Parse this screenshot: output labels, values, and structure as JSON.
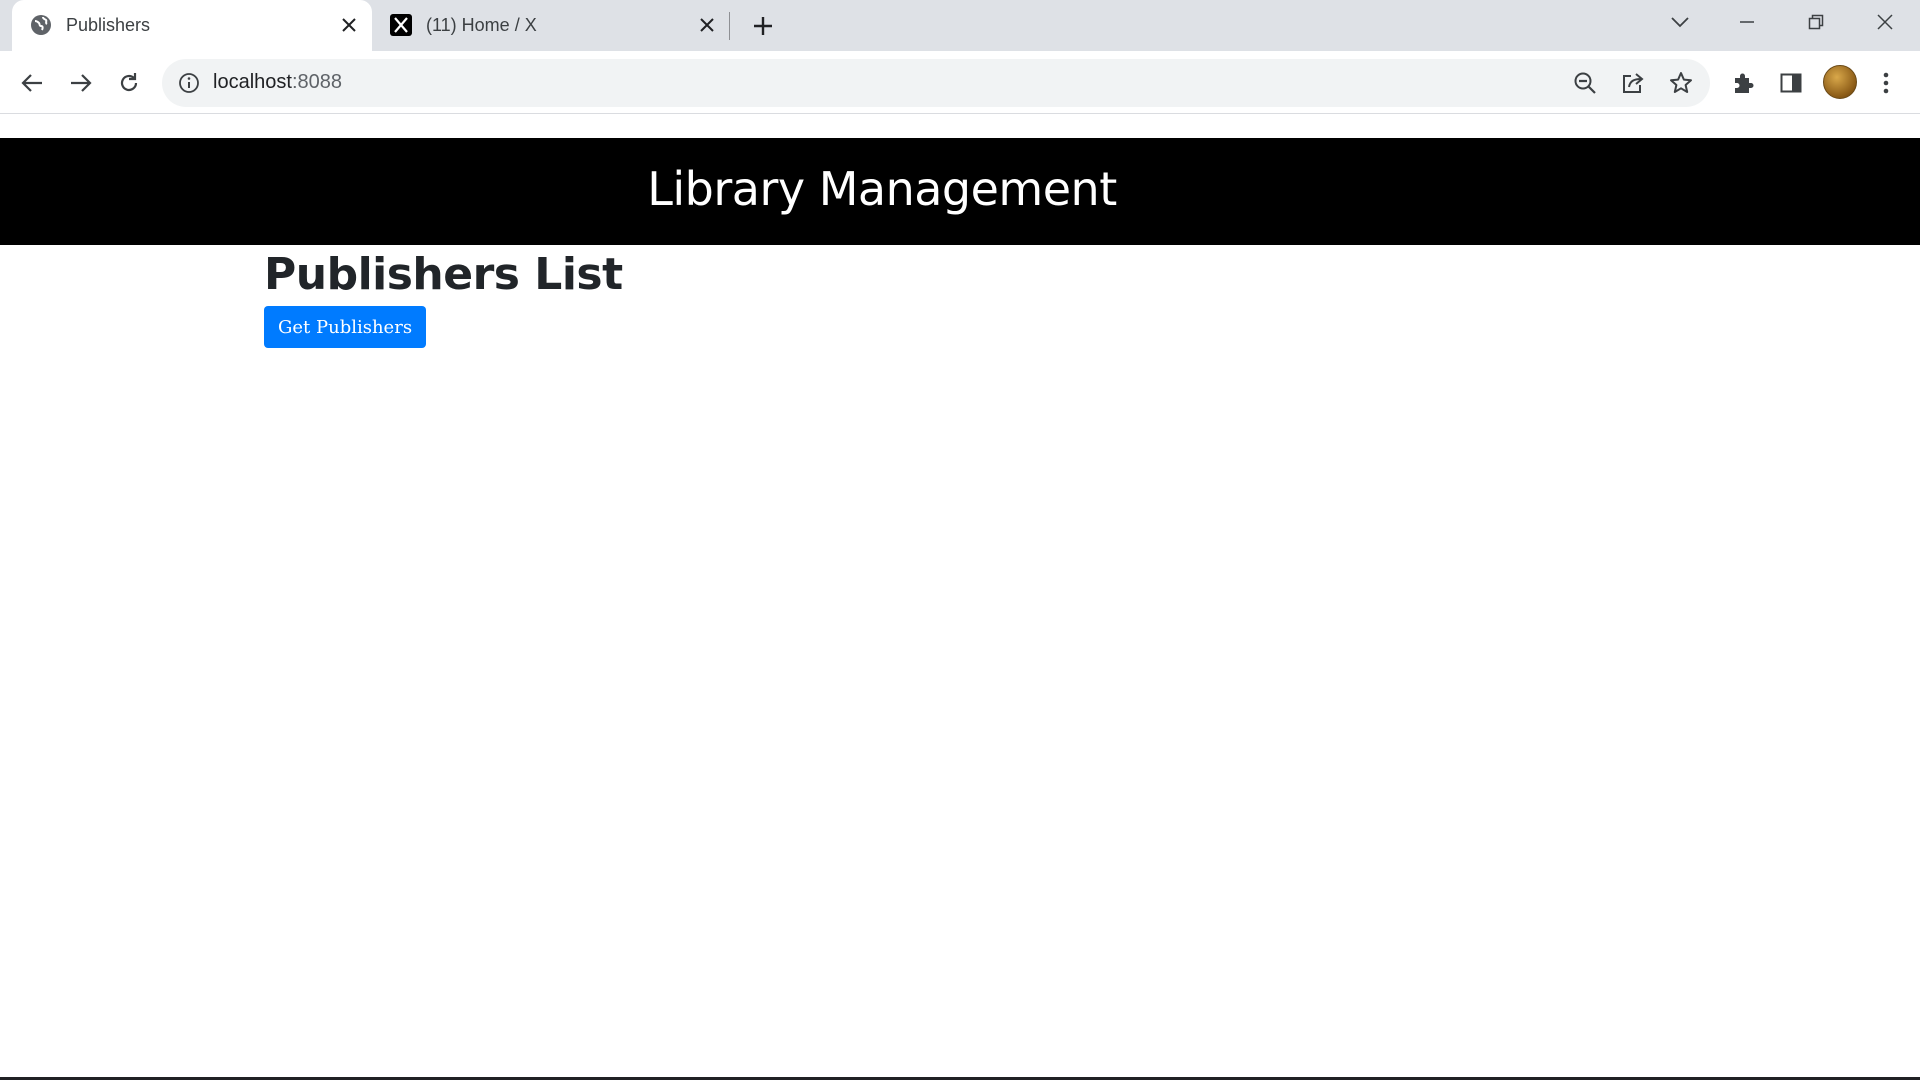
{
  "browser": {
    "tabs": [
      {
        "title": "Publishers",
        "icon": "globe-icon",
        "active": true
      },
      {
        "title": "(11) Home / X",
        "icon": "x-logo-icon",
        "active": false
      }
    ],
    "address_bar": {
      "host": "localhost",
      "port": ":8088"
    }
  },
  "page": {
    "header_title": "Library Management",
    "section_title": "Publishers List",
    "get_button_label": "Get Publishers"
  },
  "colors": {
    "header_bg": "#000000",
    "primary_button": "#007bff",
    "tabstrip_bg": "#dee1e6"
  }
}
